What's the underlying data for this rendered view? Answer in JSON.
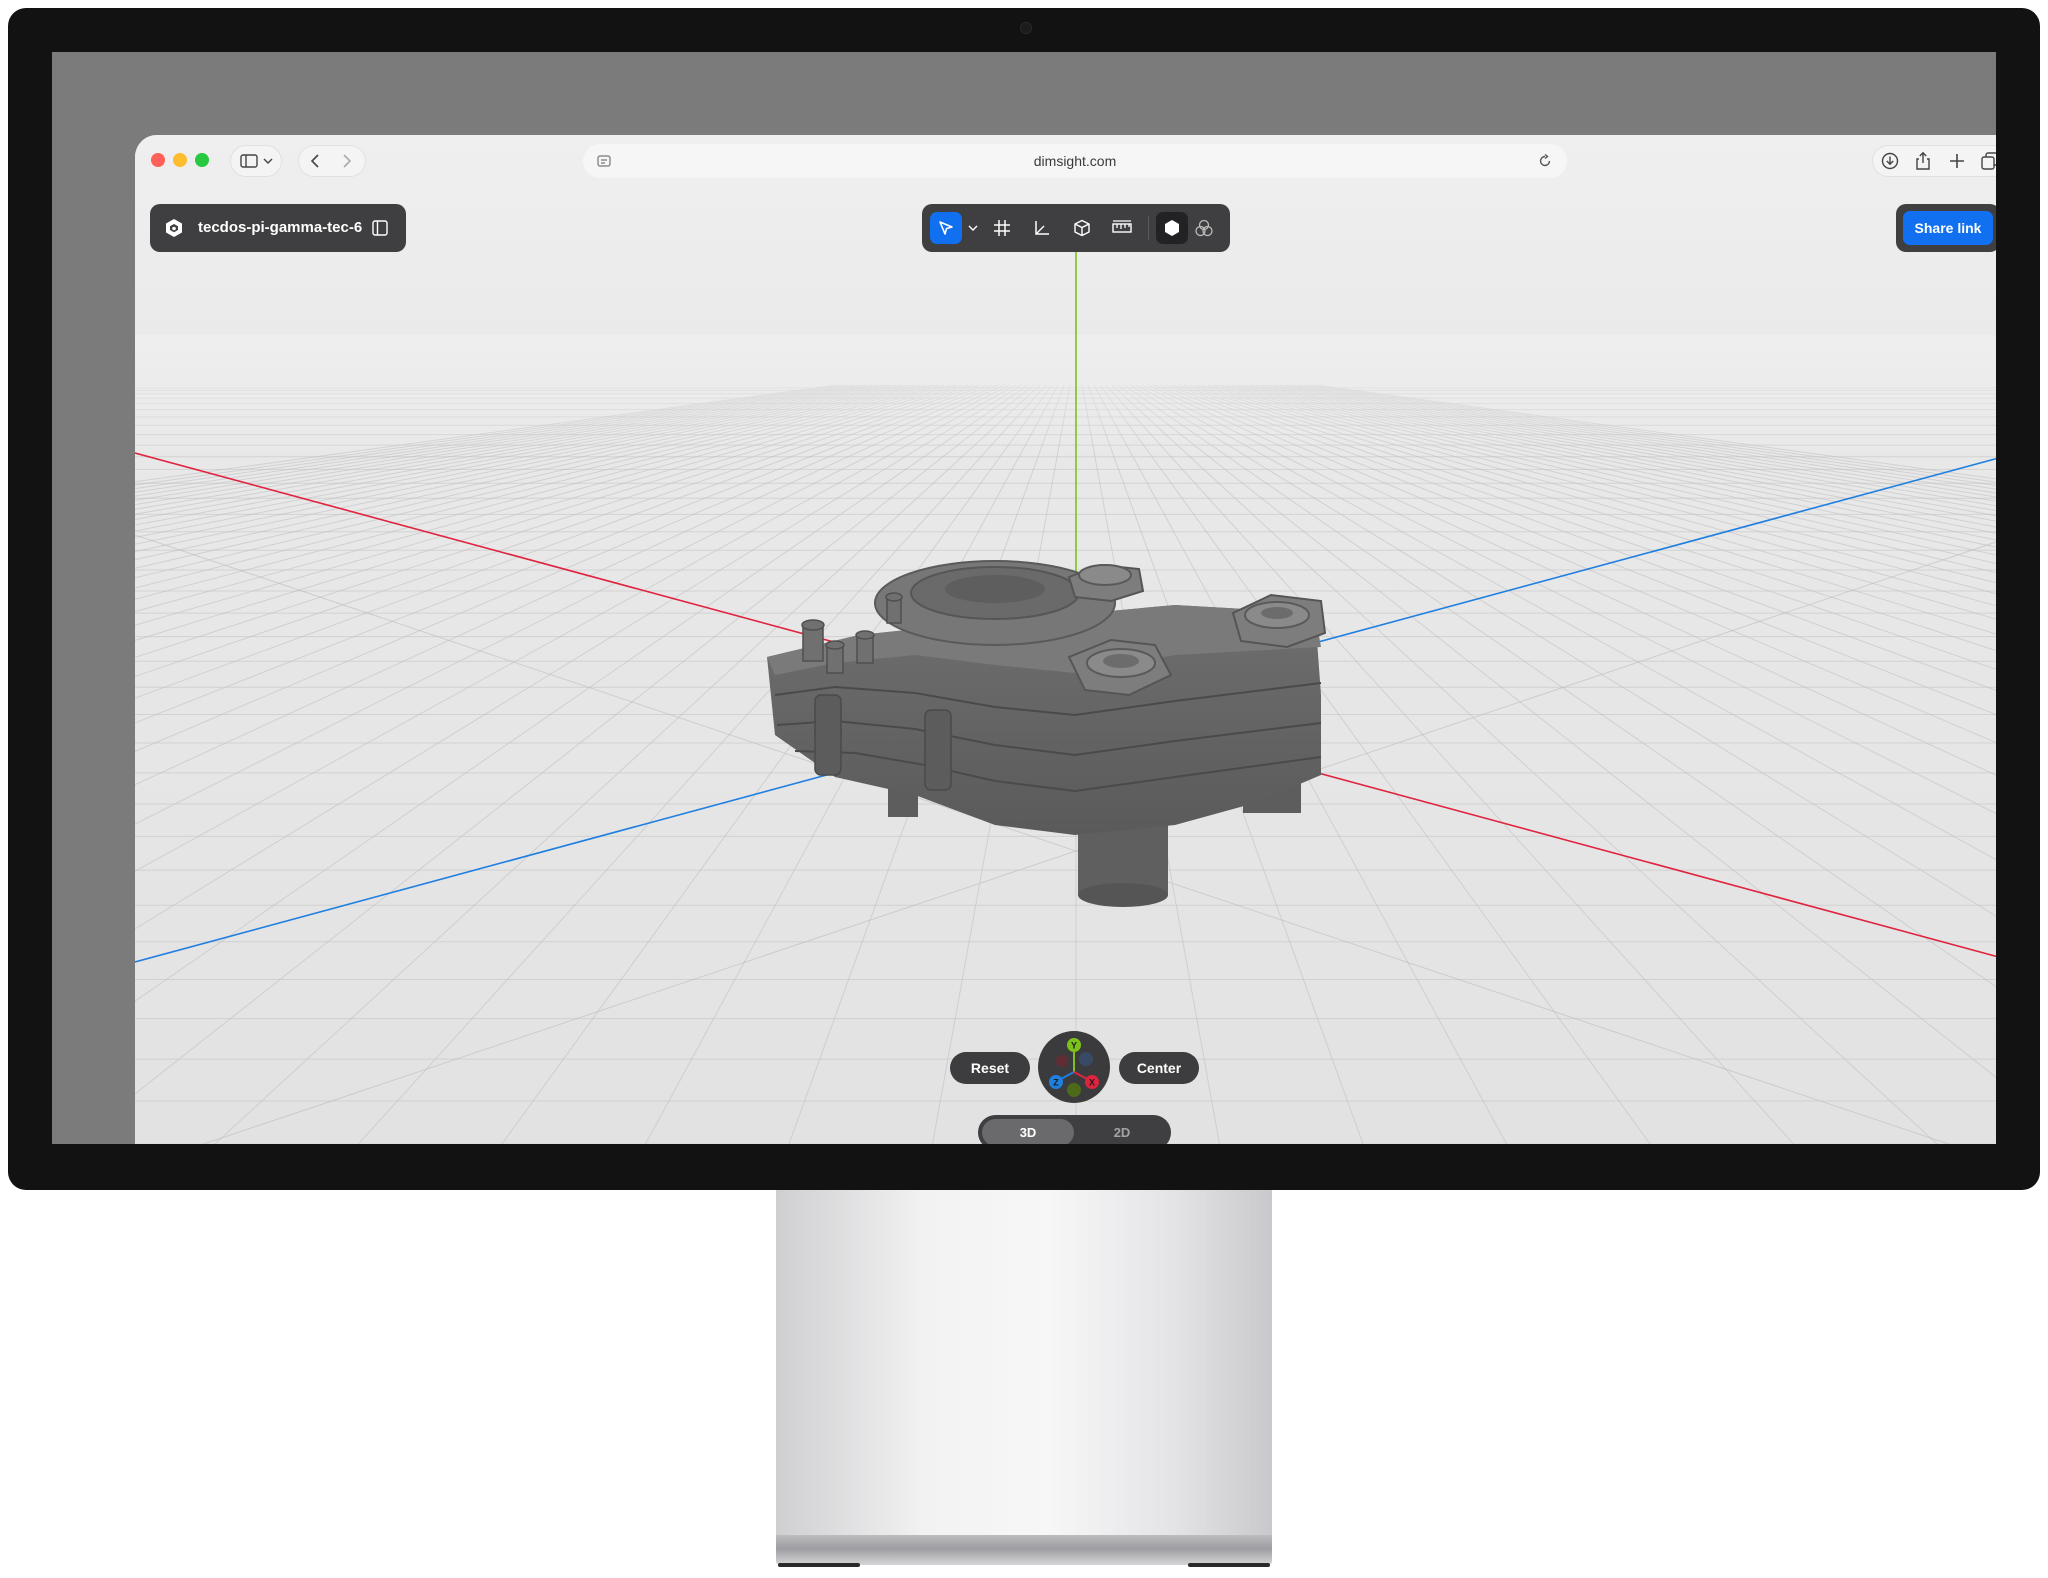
{
  "browser": {
    "url": "dimsight.com",
    "traffic_lights": {
      "close": "#fe5f57",
      "minimize": "#febc2e",
      "zoom": "#28c840"
    },
    "toolbar_icons": [
      "sidebar-icon",
      "chevron-down-icon",
      "back-icon",
      "forward-icon",
      "reader-icon",
      "reload-icon",
      "download-icon",
      "share-icon",
      "plus-icon",
      "tabs-icon"
    ]
  },
  "app": {
    "project_name": "tecdos-pi-gamma-tec-6",
    "share_label": "Share link",
    "accent_color": "#1070f0",
    "tools": [
      "select-icon",
      "dropdown-chevron-icon",
      "grid-icon",
      "axes-icon",
      "cube-icon",
      "measure-icon",
      "solid-shading-icon",
      "xray-shading-icon"
    ],
    "active_tool": "select-icon",
    "active_shading": "solid-shading-icon"
  },
  "viewer": {
    "reset_label": "Reset",
    "center_label": "Center",
    "view_modes": [
      "3D",
      "2D"
    ],
    "active_view": "3D",
    "gizmo_axes": {
      "y": "Y",
      "z": "Z",
      "x": "X"
    },
    "axis_colors": {
      "x": "#e0233f",
      "y": "#7cc21c",
      "z": "#1f7fe0"
    }
  }
}
